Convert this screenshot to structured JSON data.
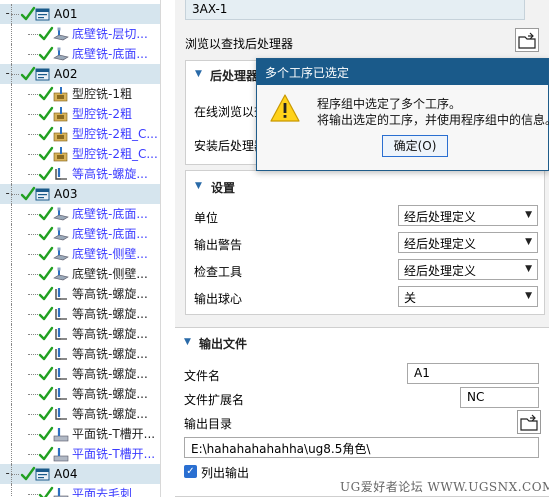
{
  "tree": {
    "rows": [
      {
        "type": "group",
        "label": "A01",
        "toggle": "-"
      },
      {
        "type": "op",
        "label": "底壁铣-层切...",
        "icon": "floor",
        "color": "blue"
      },
      {
        "type": "op",
        "label": "底壁铣-底面...",
        "icon": "floor",
        "color": "blue"
      },
      {
        "type": "group",
        "label": "A02",
        "toggle": "-"
      },
      {
        "type": "op",
        "label": "型腔铣-1粗",
        "icon": "cavity",
        "color": "dark"
      },
      {
        "type": "op",
        "label": "型腔铣-2粗",
        "icon": "cavity",
        "color": "blue"
      },
      {
        "type": "op",
        "label": "型腔铣-2粗_C...",
        "icon": "cavity",
        "color": "blue"
      },
      {
        "type": "op",
        "label": "型腔铣-2粗_C...",
        "icon": "cavity",
        "color": "blue"
      },
      {
        "type": "op",
        "label": "等高铣-螺旋...",
        "icon": "zlevel",
        "color": "blue"
      },
      {
        "type": "group",
        "label": "A03",
        "toggle": "-"
      },
      {
        "type": "op",
        "label": "底壁铣-底面...",
        "icon": "floor",
        "color": "blue"
      },
      {
        "type": "op",
        "label": "底壁铣-底面...",
        "icon": "floor",
        "color": "blue"
      },
      {
        "type": "op",
        "label": "底壁铣-侧壁...",
        "icon": "floor",
        "color": "blue"
      },
      {
        "type": "op",
        "label": "底壁铣-侧壁...",
        "icon": "floor",
        "color": "dark"
      },
      {
        "type": "op",
        "label": "等高铣-螺旋...",
        "icon": "zlevel",
        "color": "dark"
      },
      {
        "type": "op",
        "label": "等高铣-螺旋...",
        "icon": "zlevel",
        "color": "dark"
      },
      {
        "type": "op",
        "label": "等高铣-螺旋...",
        "icon": "zlevel",
        "color": "dark"
      },
      {
        "type": "op",
        "label": "等高铣-螺旋...",
        "icon": "zlevel",
        "color": "dark"
      },
      {
        "type": "op",
        "label": "等高铣-螺旋...",
        "icon": "zlevel",
        "color": "dark"
      },
      {
        "type": "op",
        "label": "等高铣-螺旋...",
        "icon": "zlevel",
        "color": "dark"
      },
      {
        "type": "op",
        "label": "等高铣-螺旋...",
        "icon": "zlevel",
        "color": "dark"
      },
      {
        "type": "op",
        "label": "平面铣-T槽开...",
        "icon": "planar",
        "color": "dark"
      },
      {
        "type": "op",
        "label": "平面铣-T槽开...",
        "icon": "planar",
        "color": "blue"
      },
      {
        "type": "group",
        "label": "A04",
        "toggle": "-"
      },
      {
        "type": "op",
        "label": "平面去毛刺",
        "icon": "planar",
        "color": "blue"
      }
    ]
  },
  "panel": {
    "top_value": "3AX-1",
    "browse_label": "浏览以查找后处理器",
    "post_section": {
      "title": "后处理器",
      "online_label": "在线浏览以查",
      "install_label": "安装后处理器"
    },
    "settings": {
      "title": "设置",
      "rows": [
        {
          "label": "单位",
          "value": "经后处理定义"
        },
        {
          "label": "输出警告",
          "value": "经后处理定义"
        },
        {
          "label": "检查工具",
          "value": "经后处理定义"
        },
        {
          "label": "输出球心",
          "value": "关"
        }
      ]
    },
    "output": {
      "title": "输出文件",
      "filename_label": "文件名",
      "filename_value": "A1",
      "ext_label": "文件扩展名",
      "ext_value": "NC",
      "dir_label": "输出目录",
      "dir_value": "E:\\hahahahahahha\\ug8.5角色\\",
      "list_label": "列出输出"
    }
  },
  "dialog": {
    "title": "多个工序已选定",
    "line1": "程序组中选定了多个工序。",
    "line2": "将输出选定的工序，并使用程序组中的信息。",
    "ok": "确定(O)"
  },
  "watermark": "UG爱好者论坛 WWW.UGSNX.COM",
  "colors": {
    "group_bg": "#d6e5ee",
    "link_blue": "#3c3cff",
    "check_green": "#22a022",
    "titlebar": "#1a5a8a",
    "accent": "#2a6fd1"
  }
}
